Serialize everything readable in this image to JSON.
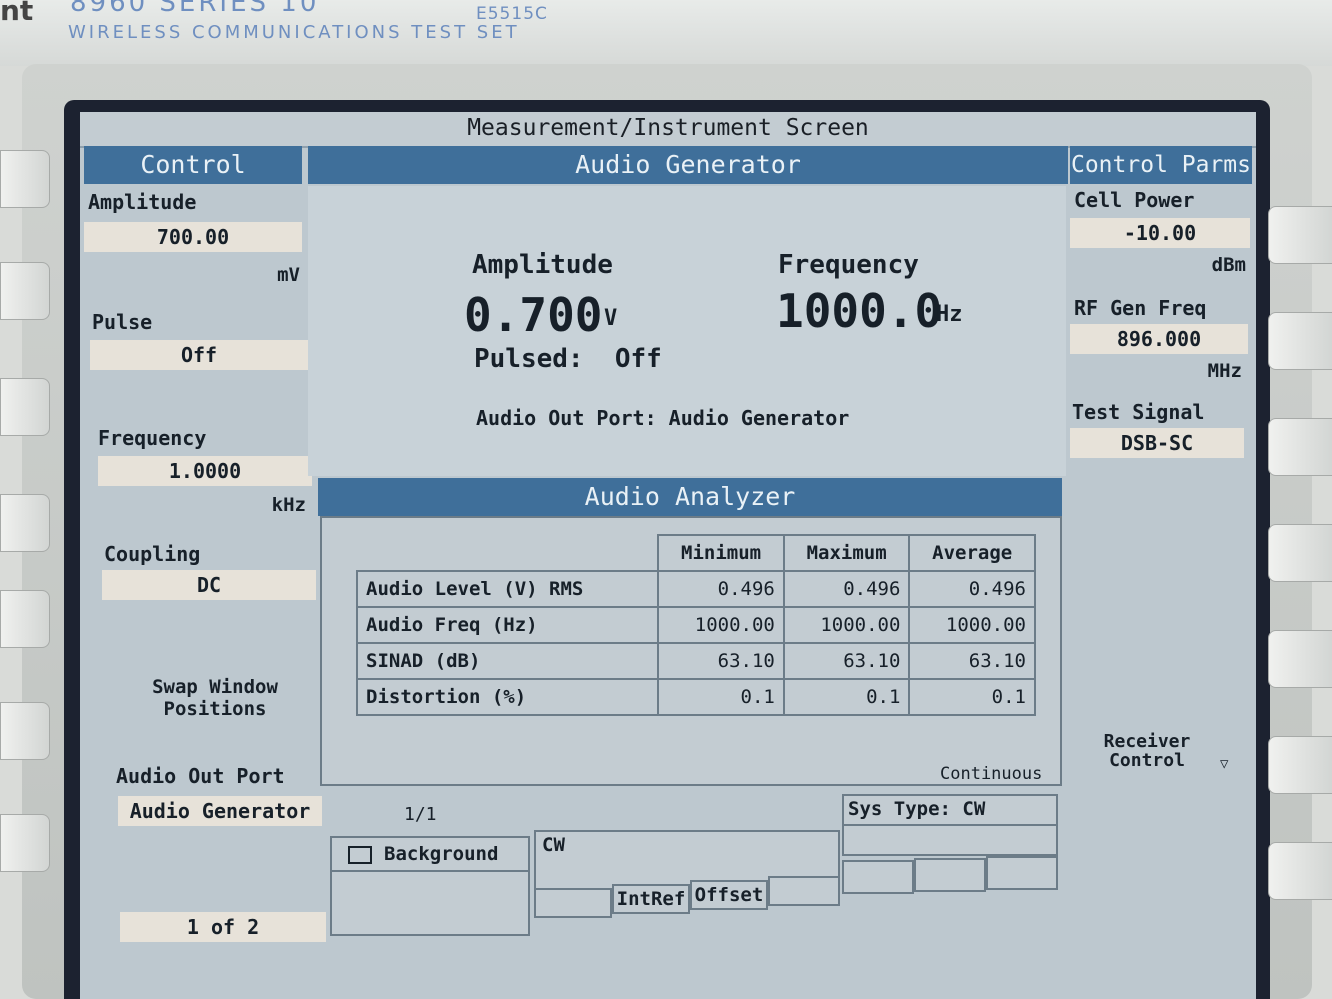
{
  "bezel": {
    "logo_fragment": "nt",
    "series": "8960  SERIES 10",
    "model": "E5515C",
    "subtitle": "WIRELESS COMMUNICATIONS TEST SET"
  },
  "screen_title": "Measurement/Instrument Screen",
  "control": {
    "header": "Control",
    "amplitude_label": "Amplitude",
    "amplitude_value": "700.00",
    "amplitude_unit": "mV",
    "pulse_label": "Pulse",
    "pulse_value": "Off",
    "frequency_label": "Frequency",
    "frequency_value": "1.0000",
    "frequency_unit": "kHz",
    "coupling_label": "Coupling",
    "coupling_value": "DC",
    "swap_label": "Swap Window Positions",
    "audio_out_label": "Audio Out Port",
    "audio_out_value": "Audio Generator",
    "page": "1 of 2"
  },
  "generator": {
    "header": "Audio Generator",
    "amplitude_label": "Amplitude",
    "amplitude_value": "0.700",
    "amplitude_unit": "V",
    "frequency_label": "Frequency",
    "frequency_value": "1000.0",
    "frequency_unit": "Hz",
    "pulsed_text": "Pulsed:  Off",
    "port_text": "Audio Out Port: Audio Generator"
  },
  "analyzer": {
    "header": "Audio Analyzer",
    "columns": [
      "Minimum",
      "Maximum",
      "Average"
    ],
    "rows": [
      {
        "name": "Audio Level (V) RMS",
        "min": "0.496",
        "max": "0.496",
        "avg": "0.496"
      },
      {
        "name": "Audio Freq (Hz)",
        "min": "1000.00",
        "max": "1000.00",
        "avg": "1000.00"
      },
      {
        "name": "SINAD (dB)",
        "min": "63.10",
        "max": "63.10",
        "avg": "63.10"
      },
      {
        "name": "Distortion (%)",
        "min": "0.1",
        "max": "0.1",
        "avg": "0.1"
      }
    ],
    "mode": "Continuous",
    "page": "1/1"
  },
  "parms": {
    "header": "Control Parms",
    "cell_power_label": "Cell Power",
    "cell_power_value": "-10.00",
    "cell_power_unit": "dBm",
    "rf_gen_label": "RF Gen Freq",
    "rf_gen_value": "896.000",
    "rf_gen_unit": "MHz",
    "test_signal_label": "Test Signal",
    "test_signal_value": "DSB-SC",
    "receiver_label": "Receiver Control"
  },
  "status": {
    "background": "Background",
    "mode": "CW",
    "intref": "IntRef",
    "offset": "Offset",
    "sys_type": "Sys Type: CW"
  }
}
